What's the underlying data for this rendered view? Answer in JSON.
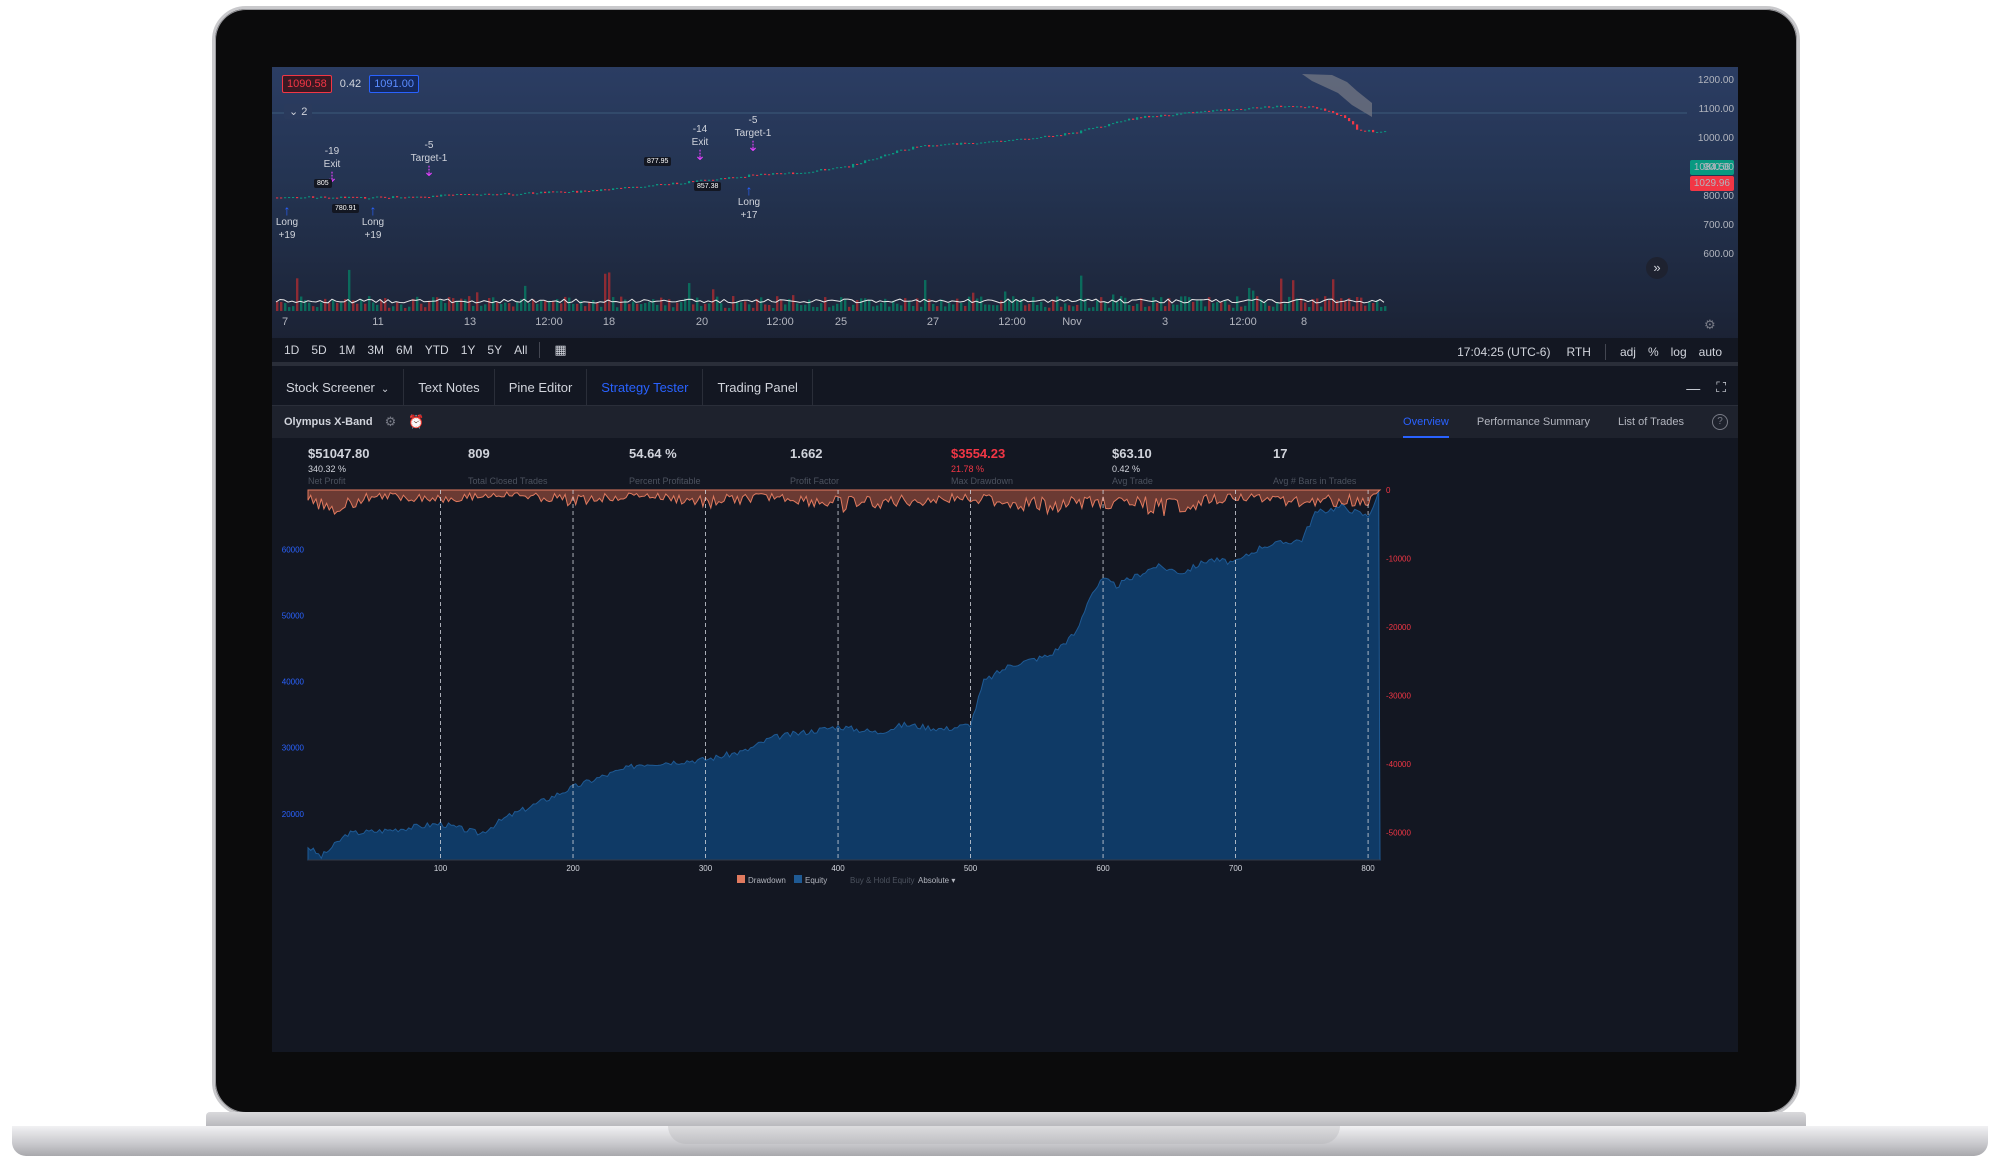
{
  "bid": "1090.58",
  "spread": "0.42",
  "ask": "1091.00",
  "collapse_label": "2",
  "price_axis": [
    "1200.00",
    "1100.00",
    "1000.00",
    "900.00",
    "800.00",
    "700.00",
    "600.00"
  ],
  "last_price_tag": "1084.56",
  "low_price_tag": "1029.96",
  "time_labels": [
    "7",
    "11",
    "13",
    "12:00",
    "18",
    "20",
    "12:00",
    "25",
    "27",
    "12:00",
    "Nov",
    "3",
    "12:00",
    "8"
  ],
  "annotations": [
    {
      "type": "buy",
      "text1": "Long",
      "text2": "+19"
    },
    {
      "type": "sell",
      "text1": "-19",
      "text2": "Exit"
    },
    {
      "type": "buy",
      "text1": "Long",
      "text2": "+19"
    },
    {
      "type": "sell",
      "text1": "-5",
      "text2": "Target-1"
    },
    {
      "type": "sell",
      "text1": "-14",
      "text2": "Exit"
    },
    {
      "type": "buy",
      "text1": "Long",
      "text2": "+17"
    },
    {
      "type": "sell",
      "text1": "-5",
      "text2": "Target-1"
    }
  ],
  "price_labels": [
    "805",
    "780.91",
    "877.95",
    "857.38"
  ],
  "range_buttons": [
    "1D",
    "5D",
    "1M",
    "3M",
    "6M",
    "YTD",
    "1Y",
    "5Y",
    "All"
  ],
  "clock": "17:04:25 (UTC-6)",
  "session": "RTH",
  "scale_buttons": [
    "adj",
    "%",
    "log",
    "auto"
  ],
  "panel_tabs": [
    "Stock Screener",
    "Text Notes",
    "Pine Editor",
    "Strategy Tester",
    "Trading Panel"
  ],
  "active_panel_tab": "Strategy Tester",
  "strategy_name": "Olympus X-Band",
  "strategy_tabs": [
    "Overview",
    "Performance Summary",
    "List of Trades"
  ],
  "active_strategy_tab": "Overview",
  "metrics": [
    {
      "value": "$51047.80",
      "sub": "340.32 %",
      "label": "Net Profit",
      "negative": false
    },
    {
      "value": "809",
      "sub": "",
      "label": "Total Closed Trades",
      "negative": false
    },
    {
      "value": "54.64 %",
      "sub": "",
      "label": "Percent Profitable",
      "negative": false
    },
    {
      "value": "1.662",
      "sub": "",
      "label": "Profit Factor",
      "negative": false
    },
    {
      "value": "$3554.23",
      "sub": "21.78 %",
      "label": "Max Drawdown",
      "negative": true
    },
    {
      "value": "$63.10",
      "sub": "0.42 %",
      "label": "Avg Trade",
      "negative": false
    },
    {
      "value": "17",
      "sub": "",
      "label": "Avg # Bars in Trades",
      "negative": false
    }
  ],
  "legend": {
    "drawdown": "Drawdown",
    "equity": "Equity",
    "buy_hold": "Buy & Hold Equity",
    "mode": "Absolute"
  },
  "colors": {
    "equity": "#0f3a66",
    "drawdown": "#e07a5f",
    "accent": "#2962ff",
    "up": "#089981",
    "down": "#f23645"
  },
  "chart_data": {
    "type": "area",
    "x_ticks": [
      100,
      200,
      300,
      400,
      500,
      600,
      700,
      800
    ],
    "y_left_ticks": [
      20000,
      30000,
      40000,
      50000,
      60000
    ],
    "y_right_ticks": [
      0,
      -10000,
      -20000,
      -30000,
      -40000,
      -50000
    ],
    "xlim": [
      0,
      809
    ],
    "ylim_equity": [
      13000,
      69000
    ],
    "ylim_drawdown": [
      -54000,
      0
    ],
    "series": [
      {
        "name": "Equity",
        "x": [
          0,
          10,
          30,
          60,
          100,
          130,
          150,
          200,
          220,
          250,
          300,
          330,
          350,
          380,
          400,
          430,
          450,
          480,
          500,
          510,
          530,
          560,
          580,
          590,
          600,
          610,
          640,
          660,
          680,
          700,
          720,
          750,
          760,
          780,
          800,
          809
        ],
        "values": [
          15000,
          13500,
          17000,
          17500,
          18500,
          17000,
          19500,
          24000,
          25500,
          27500,
          28200,
          29500,
          31500,
          32500,
          33200,
          32300,
          33500,
          32800,
          33500,
          40000,
          42500,
          44000,
          47500,
          53000,
          55500,
          54500,
          57500,
          56500,
          58500,
          58000,
          60500,
          61500,
          65500,
          66500,
          65000,
          69000
        ]
      },
      {
        "name": "Drawdown",
        "x": [
          0,
          20,
          50,
          100,
          150,
          200,
          250,
          300,
          350,
          400,
          450,
          500,
          550,
          600,
          650,
          700,
          750,
          800,
          809
        ],
        "values": [
          -1500,
          -2600,
          -900,
          -1300,
          -700,
          -1600,
          -800,
          -1900,
          -1000,
          -2200,
          -1700,
          -1200,
          -2400,
          -1800,
          -2600,
          -1000,
          -1700,
          -1600,
          0
        ]
      }
    ]
  }
}
